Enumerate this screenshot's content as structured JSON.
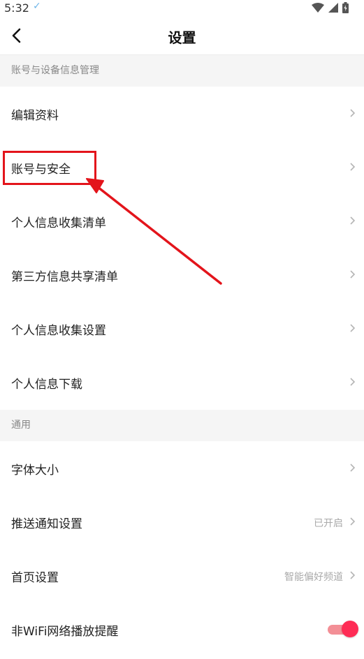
{
  "status_bar": {
    "time": "5:32",
    "icons": [
      "check-icon",
      "wifi-icon",
      "signal-icon",
      "battery-icon"
    ]
  },
  "header": {
    "title": "设置",
    "back_icon": "chevron-left-icon"
  },
  "sections": [
    {
      "title": "账号与设备信息管理",
      "items": [
        {
          "label": "编辑资料"
        },
        {
          "label": "账号与安全"
        },
        {
          "label": "个人信息收集清单"
        },
        {
          "label": "第三方信息共享清单"
        },
        {
          "label": "个人信息收集设置"
        },
        {
          "label": "个人信息下载"
        }
      ]
    },
    {
      "title": "通用",
      "items": [
        {
          "label": "字体大小"
        },
        {
          "label": "推送通知设置",
          "value": "已开启"
        },
        {
          "label": "首页设置",
          "value": "智能偏好频道"
        },
        {
          "label": "非WiFi网络播放提醒",
          "toggle": true
        }
      ]
    }
  ],
  "annotation": {
    "highlight_color": "#e3141b",
    "highlighted_item": "账号与安全"
  },
  "colors": {
    "toggle_on": "#fe2c55",
    "section_bg": "#f5f5f5"
  }
}
